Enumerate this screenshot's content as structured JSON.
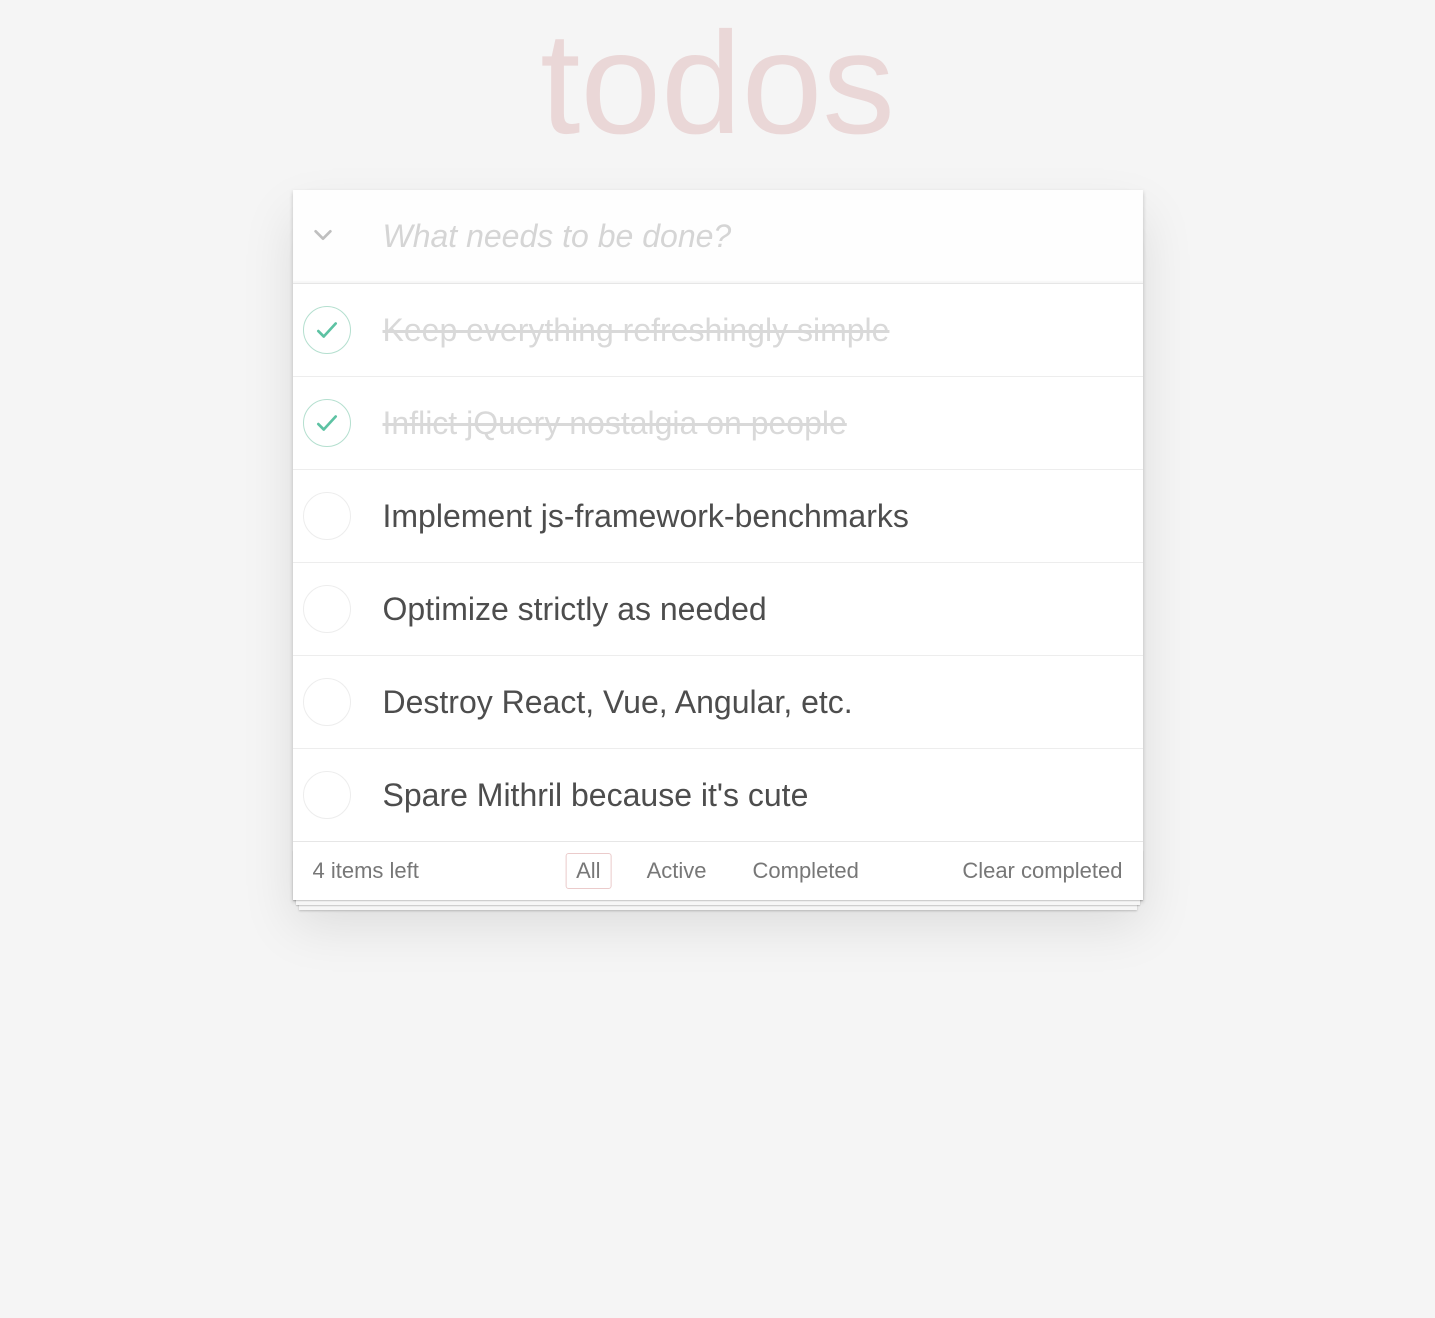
{
  "title": "todos",
  "input": {
    "placeholder": "What needs to be done?",
    "value": ""
  },
  "todos": [
    {
      "label": "Keep everything refreshingly simple",
      "completed": true
    },
    {
      "label": "Inflict jQuery nostalgia on people",
      "completed": true
    },
    {
      "label": "Implement js-framework-benchmarks",
      "completed": false
    },
    {
      "label": "Optimize strictly as needed",
      "completed": false
    },
    {
      "label": "Destroy React, Vue, Angular, etc.",
      "completed": false
    },
    {
      "label": "Spare Mithril because it's cute",
      "completed": false
    }
  ],
  "footer": {
    "count_text": "4 items left",
    "filters": [
      {
        "label": "All",
        "selected": true
      },
      {
        "label": "Active",
        "selected": false
      },
      {
        "label": "Completed",
        "selected": false
      }
    ],
    "clear_label": "Clear completed"
  }
}
